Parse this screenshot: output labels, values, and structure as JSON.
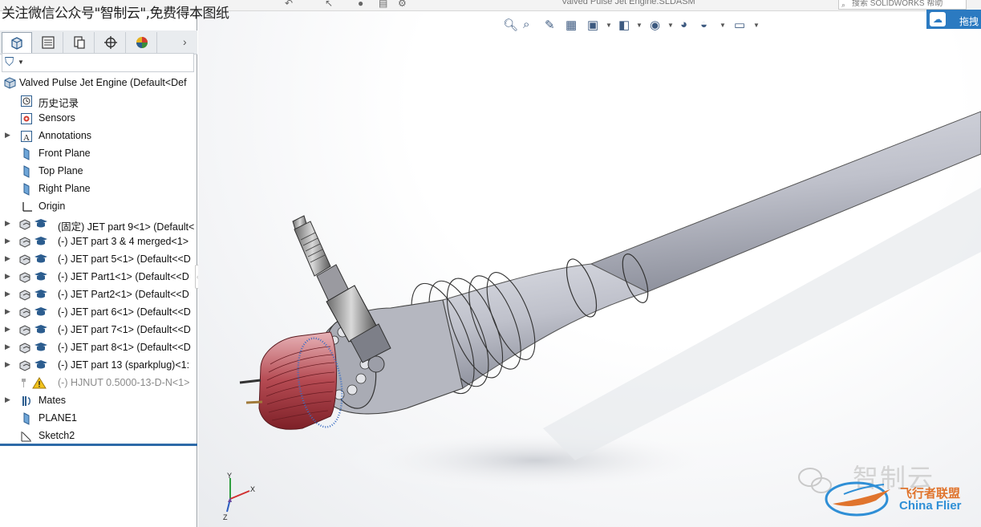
{
  "overlay": {
    "text": "关注微信公众号\"智制云\",免费得本图纸"
  },
  "window": {
    "title": "Valved Pulse Jet Engine.SLDASM",
    "search_placeholder": "搜索 SOLIDWORKS 帮助",
    "corner_button_label": "拖拽"
  },
  "panel": {
    "tabs": [
      {
        "name": "featuremanager-tab",
        "icon": "featuremanager-icon"
      },
      {
        "name": "propertymanager-tab",
        "icon": "propertymanager-icon"
      },
      {
        "name": "configurationmanager-tab",
        "icon": "configurationmanager-icon"
      },
      {
        "name": "dimxpert-tab",
        "icon": "dimxpert-icon"
      },
      {
        "name": "display-manager-tab",
        "icon": "display-manager-icon"
      }
    ],
    "more_arrow": "›",
    "filter_icon": "filter-icon"
  },
  "tree": {
    "root": {
      "label": "Valved Pulse Jet Engine  (Default<Def"
    },
    "items": [
      {
        "label": "历史记录",
        "icon": "history-icon",
        "expandable": false
      },
      {
        "label": "Sensors",
        "icon": "sensors-icon",
        "expandable": false
      },
      {
        "label": "Annotations",
        "icon": "annotations-icon",
        "expandable": true
      },
      {
        "label": "Front Plane",
        "icon": "plane-icon",
        "expandable": false
      },
      {
        "label": "Top Plane",
        "icon": "plane-icon",
        "expandable": false
      },
      {
        "label": "Right Plane",
        "icon": "plane-icon",
        "expandable": false
      },
      {
        "label": "Origin",
        "icon": "origin-icon",
        "expandable": false
      },
      {
        "label": "(固定) JET part 9<1> (Default<",
        "icon": "part-icon",
        "expandable": true
      },
      {
        "label": "(-) JET part 3 & 4 merged<1>",
        "icon": "part-icon",
        "expandable": true
      },
      {
        "label": "(-) JET part 5<1> (Default<<D",
        "icon": "part-icon",
        "expandable": true
      },
      {
        "label": "(-) JET Part1<1> (Default<<D",
        "icon": "part-icon",
        "expandable": true
      },
      {
        "label": "(-) JET Part2<1> (Default<<D",
        "icon": "part-icon",
        "expandable": true
      },
      {
        "label": "(-) JET part 6<1> (Default<<D",
        "icon": "part-icon",
        "expandable": true
      },
      {
        "label": "(-) JET part 7<1> (Default<<D",
        "icon": "part-icon",
        "expandable": true
      },
      {
        "label": "(-) JET part 8<1> (Default<<D",
        "icon": "part-icon",
        "expandable": true
      },
      {
        "label": "(-) JET part 13 (sparkplug)<1:",
        "icon": "part-icon",
        "expandable": true
      },
      {
        "label": "(-) HJNUT 0.5000-13-D-N<1>",
        "icon": "warning-icon",
        "expandable": false,
        "dim": true
      },
      {
        "label": "Mates",
        "icon": "mates-icon",
        "expandable": true
      },
      {
        "label": "PLANE1",
        "icon": "plane-icon",
        "expandable": false
      },
      {
        "label": "Sketch2",
        "icon": "sketch-icon",
        "expandable": false
      }
    ]
  },
  "triad": {
    "x": "X",
    "y": "Y",
    "z": "Z"
  },
  "watermark": {
    "text": "智制云",
    "brand": "飞行者联盟",
    "brand_en": "China Flier"
  },
  "colors": {
    "selection_blue": "#2d6aa8",
    "icon_blue": "#2c5d8f",
    "tube_fill": "#c7c9d1",
    "nozzle_red": "#a5323a",
    "ring_blue": "#3b6ec2"
  }
}
